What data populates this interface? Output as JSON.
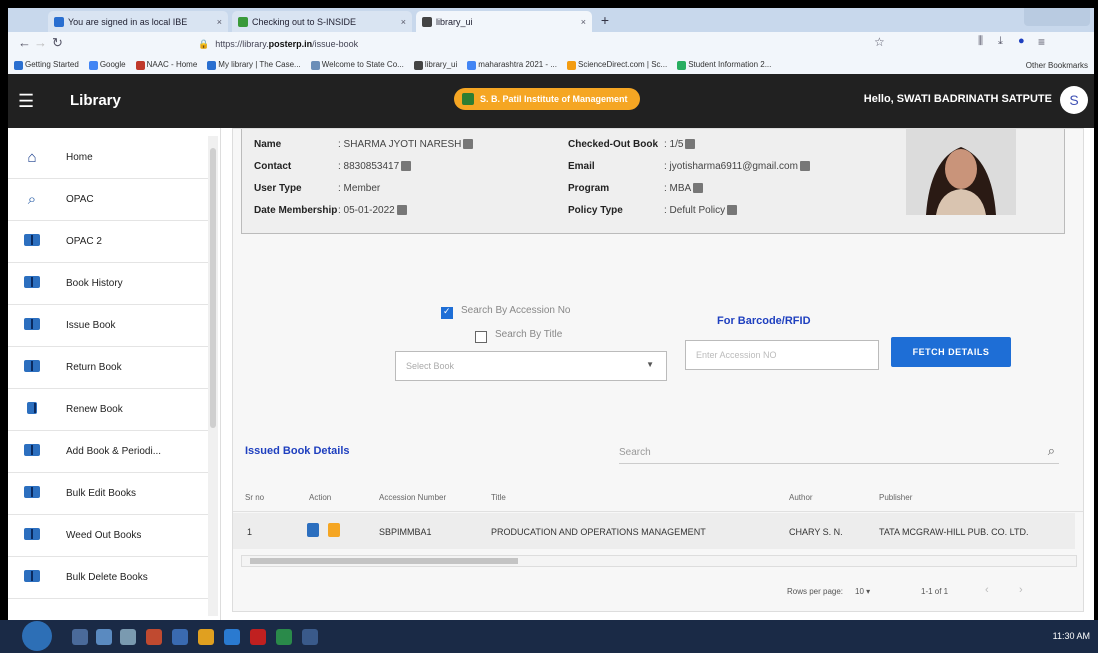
{
  "browser": {
    "tabs": [
      {
        "label": "You are signed in as local IBE",
        "active": false,
        "color": "#2a6fd0"
      },
      {
        "label": "Checking out to S-INSIDE",
        "active": false,
        "color": "#3a9a3a"
      },
      {
        "label": "library_ui",
        "active": true,
        "color": "#444444"
      }
    ],
    "url_prefix": "https://library.",
    "url_host": "posterp.in",
    "url_path": "/issue-book",
    "bookmarks": [
      "Getting Started",
      "Google",
      "NAAC - Home",
      "My library | The Case...",
      "Welcome to State Co...",
      "library_ui",
      "maharashtra 2021 - ...",
      "ScienceDirect.com | Sc...",
      "Student Information 2..."
    ],
    "other_bookmarks": "Other Bookmarks"
  },
  "header": {
    "menu_icon": "hamburger-icon",
    "title": "Library",
    "institute": "S. B. Patil Institute of Management",
    "greeting": "Hello, SWATI BADRINATH SATPUTE",
    "avatar_letter": "S"
  },
  "sidebar": {
    "items": [
      {
        "label": "Home",
        "icon": "home-icon"
      },
      {
        "label": "OPAC",
        "icon": "search-icon"
      },
      {
        "label": "OPAC 2",
        "icon": "book-icon"
      },
      {
        "label": "Book History",
        "icon": "book-icon"
      },
      {
        "label": "Issue Book",
        "icon": "book-icon"
      },
      {
        "label": "Return Book",
        "icon": "book-icon"
      },
      {
        "label": "Renew Book",
        "icon": "book-icon"
      },
      {
        "label": "Add Book & Periodi...",
        "icon": "book-icon"
      },
      {
        "label": "Bulk Edit Books",
        "icon": "book-icon"
      },
      {
        "label": "Weed Out Books",
        "icon": "book-icon"
      },
      {
        "label": "Bulk Delete Books",
        "icon": "book-icon"
      }
    ]
  },
  "member": {
    "name_label": "Name",
    "name_value": ": SHARMA JYOTI NARESH",
    "contact_label": "Contact",
    "contact_value": ": 8830853417",
    "usertype_label": "User Type",
    "usertype_value": ": Member",
    "membership_label": "Date Membership",
    "membership_value": ": 05-01-2022",
    "checkedout_label": "Checked-Out Book",
    "checkedout_value": ": 1/5",
    "email_label": "Email",
    "email_value": ": jyotisharma6911@gmail.com",
    "program_label": "Program",
    "program_value": ": MBA",
    "policy_label": "Policy Type",
    "policy_value": ": Defult Policy"
  },
  "search_opts": {
    "by_accession": "Search By Accession No",
    "by_title": "Search By Title",
    "select_placeholder": "Select Book",
    "barcode_heading": "For Barcode/RFID",
    "accession_placeholder": "Enter Accession NO",
    "fetch_label": "FETCH DETAILS"
  },
  "issued": {
    "title": "Issued Book Details",
    "search_placeholder": "Search",
    "columns": [
      "Sr no",
      "Action",
      "Accession Number",
      "Title",
      "Author",
      "Publisher"
    ],
    "rows": [
      {
        "sr": "1",
        "accession": "SBPIMMBA1",
        "title": "PRODUCATION AND OPERATIONS MANAGEMENT",
        "author": "CHARY S. N.",
        "publisher": "TATA MCGRAW-HILL PUB. CO. LTD."
      }
    ],
    "rows_per_page_label": "Rows per page:",
    "rows_per_page": "10",
    "range": "1-1 of 1"
  },
  "taskbar": {
    "clock": "11:30 AM"
  }
}
